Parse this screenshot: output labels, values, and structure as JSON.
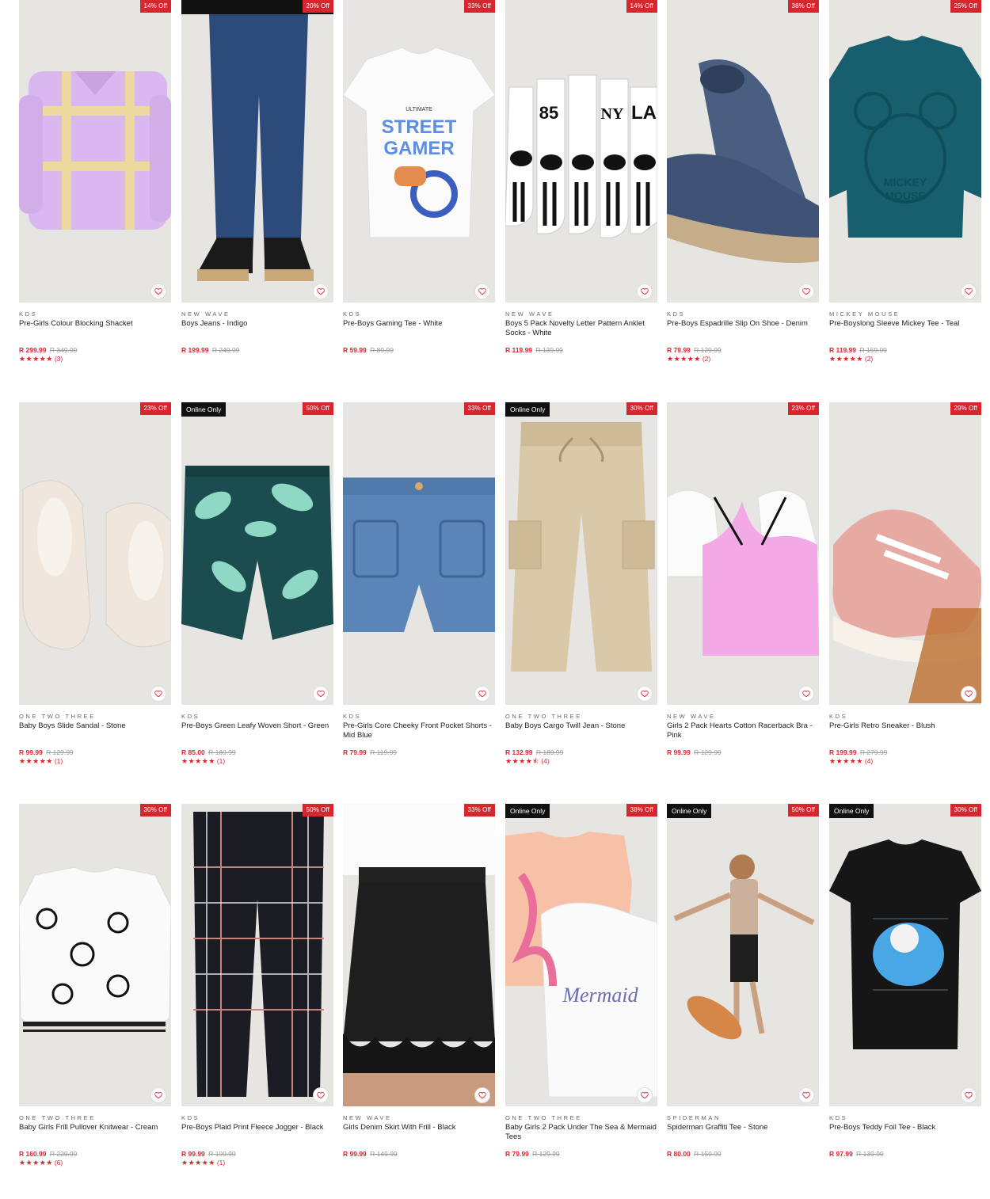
{
  "colors": {
    "sale_red": "#d8262e",
    "badge_black": "#111111",
    "tile_grey": "#e6e5e2"
  },
  "products": [
    {
      "brand": "KDS",
      "name": "Pre-Girls Colour Blocking Shacket",
      "price": "R 299.99",
      "was": "R 349.99",
      "discount": "14% Off",
      "online_only": "",
      "stars": "★★★★★",
      "reviews": "(3)",
      "image_icon": "plaid-shacket"
    },
    {
      "brand": "NEW WAVE",
      "name": "Boys Jeans - Indigo",
      "price": "R 199.99",
      "was": "R 249.99",
      "discount": "20% Off",
      "online_only": "",
      "stars": "",
      "reviews": "",
      "image_icon": "jeans"
    },
    {
      "brand": "KDS",
      "name": "Pre-Boys Gaming Tee - White",
      "price": "R 59.99",
      "was": "R 89.99",
      "discount": "33% Off",
      "online_only": "",
      "stars": "",
      "reviews": "",
      "image_icon": "white-tee"
    },
    {
      "brand": "NEW WAVE",
      "name": "Boys 5 Pack Novelty Letter Pattern Anklet Socks - White",
      "price": "R 119.99",
      "was": "R 139.99",
      "discount": "14% Off",
      "online_only": "",
      "stars": "",
      "reviews": "",
      "image_icon": "socks"
    },
    {
      "brand": "KDS",
      "name": "Pre-Boys Espadrille Slip On Shoe - Denim",
      "price": "R 79.99",
      "was": "R 129.99",
      "discount": "38% Off",
      "online_only": "",
      "stars": "★★★★★",
      "reviews": "(2)",
      "image_icon": "espadrille"
    },
    {
      "brand": "MICKEY MOUSE",
      "name": "Pre-Boyslong Sleeve Mickey Tee - Teal",
      "price": "R 119.99",
      "was": "R 159.99",
      "discount": "25% Off",
      "online_only": "",
      "stars": "★★★★★",
      "reviews": "(2)",
      "image_icon": "teal-sweater"
    },
    {
      "brand": "ONE TWO THREE",
      "name": "Baby Boys Slide Sandal - Stone",
      "price": "R 99.99",
      "was": "R 129.99",
      "discount": "23% Off",
      "online_only": "",
      "stars": "★★★★★",
      "reviews": "(1)",
      "image_icon": "slides"
    },
    {
      "brand": "KDS",
      "name": "Pre-Boys Green Leafy Woven Short - Green",
      "price": "R 85.00",
      "was": "R 169.99",
      "discount": "50% Off",
      "online_only": "Online Only",
      "stars": "★★★★★",
      "reviews": "(1)",
      "image_icon": "leaf-shorts"
    },
    {
      "brand": "KDS",
      "name": "Pre-Girls Core Cheeky Front Pocket Shorts - Mid Blue",
      "price": "R 79.99",
      "was": "R 119.99",
      "discount": "33% Off",
      "online_only": "",
      "stars": "",
      "reviews": "",
      "image_icon": "denim-shorts"
    },
    {
      "brand": "ONE TWO THREE",
      "name": "Baby Boys Cargo Twill Jean - Stone",
      "price": "R 132.99",
      "was": "R 189.99",
      "discount": "30% Off",
      "online_only": "Online Only",
      "stars": "★★★★⯪",
      "reviews": "(4)",
      "image_icon": "cargo-pants"
    },
    {
      "brand": "NEW WAVE",
      "name": "Girls 2 Pack Hearts Cotton Racerback Bra - Pink",
      "price": "R 99.99",
      "was": "R 129.99",
      "discount": "23% Off",
      "online_only": "",
      "stars": "",
      "reviews": "",
      "image_icon": "bras"
    },
    {
      "brand": "KDS",
      "name": "Pre-Girls Retro Sneaker - Blush",
      "price": "R 199.99",
      "was": "R 279.99",
      "discount": "29% Off",
      "online_only": "",
      "stars": "★★★★★",
      "reviews": "(4)",
      "image_icon": "sneaker"
    },
    {
      "brand": "ONE TWO THREE",
      "name": "Baby Girls Frill Pullover Knitwear - Cream",
      "price": "R 160.99",
      "was": "R 229.99",
      "discount": "30% Off",
      "online_only": "",
      "stars": "★★★★★",
      "reviews": "(6)",
      "image_icon": "knit-pullover"
    },
    {
      "brand": "KDS",
      "name": "Pre-Boys Plaid Print Fleece Jogger - Black",
      "price": "R 99.99",
      "was": "R 199.99",
      "discount": "50% Off",
      "online_only": "",
      "stars": "★★★★★",
      "reviews": "(1)",
      "image_icon": "plaid-jogger"
    },
    {
      "brand": "NEW WAVE",
      "name": "Girls Denim Skirt With Frill - Black",
      "price": "R 99.99",
      "was": "R 149.99",
      "discount": "33% Off",
      "online_only": "",
      "stars": "",
      "reviews": "",
      "image_icon": "denim-skirt"
    },
    {
      "brand": "ONE TWO THREE",
      "name": "Baby Girls 2 Pack Under The Sea & Mermaid Tees",
      "price": "R 79.99",
      "was": "R 129.99",
      "discount": "38% Off",
      "online_only": "Online Only",
      "stars": "",
      "reviews": "",
      "image_icon": "mermaid-tees"
    },
    {
      "brand": "SPIDERMAN",
      "name": "Spiderman Graffiti Tee - Stone",
      "price": "R 80.00",
      "was": "R 159.99",
      "discount": "50% Off",
      "online_only": "Online Only",
      "stars": "",
      "reviews": "",
      "image_icon": "boy-skateboard"
    },
    {
      "brand": "KDS",
      "name": "Pre-Boys Teddy Foil Tee - Black",
      "price": "R 97.99",
      "was": "R 139.99",
      "discount": "30% Off",
      "online_only": "Online Only",
      "stars": "",
      "reviews": "",
      "image_icon": "black-tee"
    }
  ]
}
